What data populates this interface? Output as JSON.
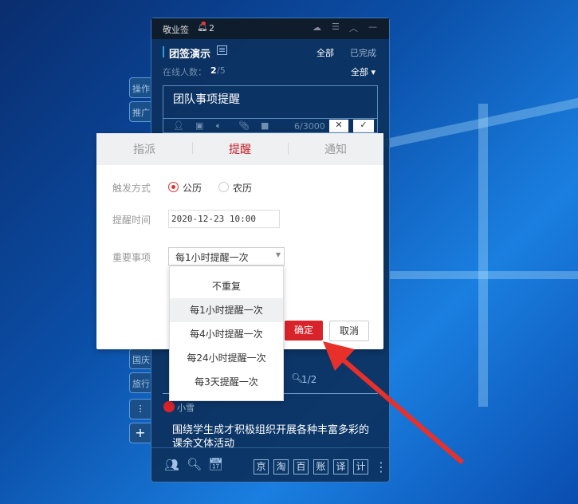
{
  "app": {
    "title": "敬业签",
    "notification_count": "2",
    "group_name": "团签演示",
    "filter_all": "全部",
    "filter_done": "已完成",
    "online_label": "在线人数：",
    "online_count": "2",
    "online_total": "/5",
    "member_filter": "全部",
    "editor_text": "团队事项提醒",
    "char_count": "6/3000",
    "side_tabs": [
      "操作",
      "推广",
      "国庆",
      "旅行"
    ],
    "page_indicator": "1/2",
    "author": "小雪",
    "note_text": "围绕学生成才积极组织开展各种丰富多彩的课余文体活动",
    "toolbar_shortcuts": [
      "京",
      "淘",
      "百",
      "账",
      "译",
      "计"
    ]
  },
  "dialog": {
    "tabs": [
      "指派",
      "提醒",
      "通知"
    ],
    "active_tab": "提醒",
    "trigger_label": "触发方式",
    "trigger_options": [
      "公历",
      "农历"
    ],
    "trigger_selected": "公历",
    "time_label": "提醒时间",
    "time_value": "2020-12-23 10:00",
    "repeat_label": "重要事项",
    "repeat_value": "每1小时提醒一次",
    "repeat_options": [
      "不重复",
      "每1小时提醒一次",
      "每4小时提醒一次",
      "每24小时提醒一次",
      "每3天提醒一次"
    ],
    "confirm": "确定",
    "cancel": "取消"
  },
  "colors": {
    "accent": "#d8232a",
    "active_tab": "#c8232c"
  }
}
